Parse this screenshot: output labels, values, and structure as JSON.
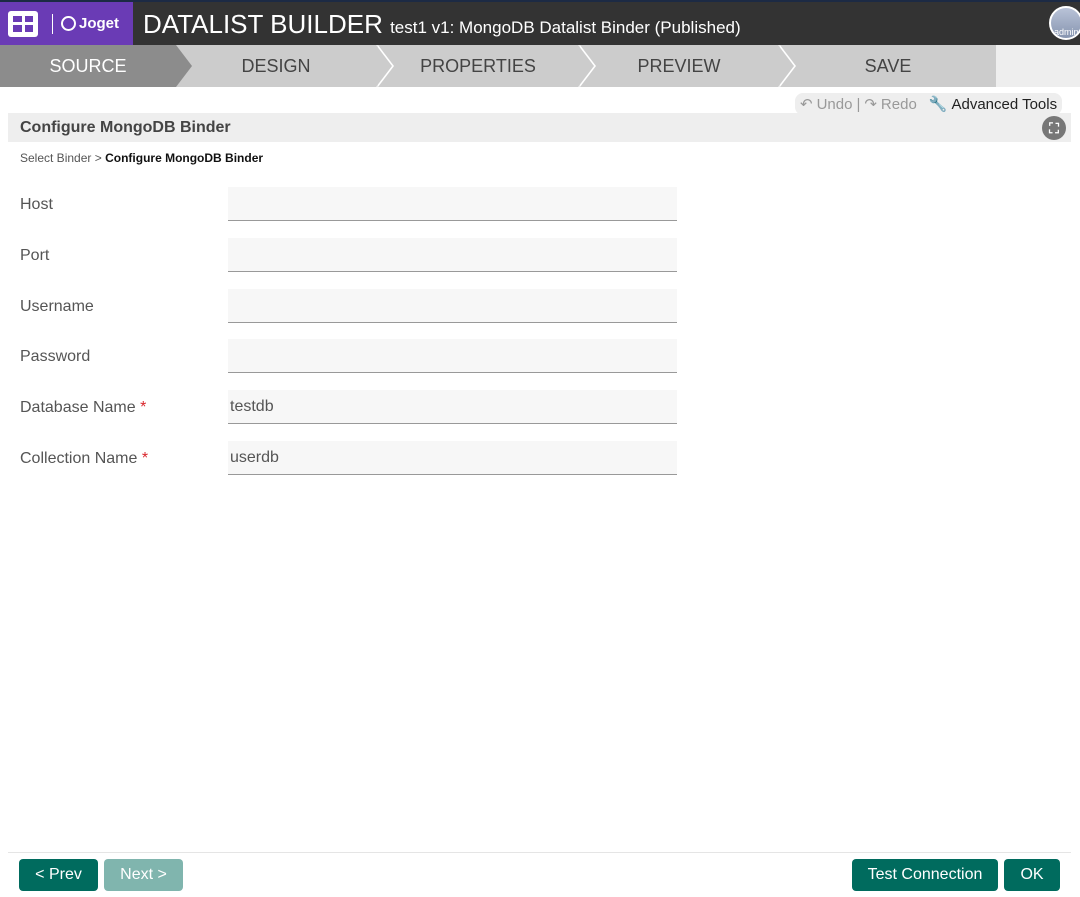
{
  "header": {
    "brand": "Joget",
    "title": "DATALIST BUILDER",
    "subtitle": "test1 v1: MongoDB Datalist Binder (Published)",
    "user": "admin"
  },
  "steps": [
    "SOURCE",
    "DESIGN",
    "PROPERTIES",
    "PREVIEW",
    "SAVE"
  ],
  "toolbar": {
    "undo": "Undo",
    "sep": "|",
    "redo": "Redo",
    "advanced": "Advanced Tools"
  },
  "panel": {
    "title": "Configure MongoDB Binder",
    "breadcrumb": [
      "Select Binder",
      ">",
      "Configure MongoDB Binder"
    ]
  },
  "fields": [
    {
      "label": "Host",
      "value": "",
      "required": false
    },
    {
      "label": "Port",
      "value": "",
      "required": false
    },
    {
      "label": "Username",
      "value": "",
      "required": false
    },
    {
      "label": "Password",
      "value": "",
      "required": false
    },
    {
      "label": "Database Name",
      "value": "testdb",
      "required": true
    },
    {
      "label": "Collection Name",
      "value": "userdb",
      "required": true
    }
  ],
  "required_mark": "*",
  "buttons": {
    "prev": "< Prev",
    "next": "Next >",
    "test": "Test Connection",
    "ok": "OK"
  }
}
